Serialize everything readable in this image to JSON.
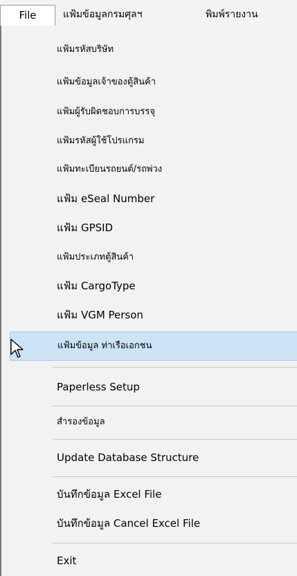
{
  "menubar": {
    "items": [
      {
        "label": "File",
        "active": true
      },
      {
        "label": "แฟ้มข้อมูลกรมศุลฯ",
        "active": false
      },
      {
        "label": "พิมพ์รายงาน",
        "active": false
      }
    ]
  },
  "file_menu": {
    "items": [
      {
        "label": "แฟ้มรหัสบริษัท"
      },
      {
        "label": "แฟ้มข้อมูลเจ้าของตู้สินค้า"
      },
      {
        "label": "แฟ้มผู้รับผิดชอบการบรรจุ"
      },
      {
        "label": "แฟ้มรหัสผู้ใช้โปรแกรม"
      },
      {
        "label": "แฟ้มทะเบียนรถยนต์/รถพ่วง"
      },
      {
        "label": "แฟ้ม eSeal Number"
      },
      {
        "label": "แฟ้ม GPSID"
      },
      {
        "label": "แฟ้มประเภทตู้สินค้า"
      },
      {
        "label": "แฟ้ม CargoType"
      },
      {
        "label": "แฟ้ม VGM Person"
      },
      {
        "label": "แฟ้มข้อมูล ท่าเรือเอกชน",
        "highlighted": true
      },
      {
        "label": "Paperless Setup"
      },
      {
        "label": "สำรองข้อมูล"
      },
      {
        "label": "Update Database Structure"
      },
      {
        "label": "บันทึกข้อมูล Excel File"
      },
      {
        "label": "บันทึกข้อมูล Cancel Excel File"
      },
      {
        "label": "Exit"
      }
    ]
  },
  "colors": {
    "highlight_bg": "#cce4f7",
    "highlight_border": "#99c9ef",
    "menu_bg": "#f2f2f2"
  }
}
